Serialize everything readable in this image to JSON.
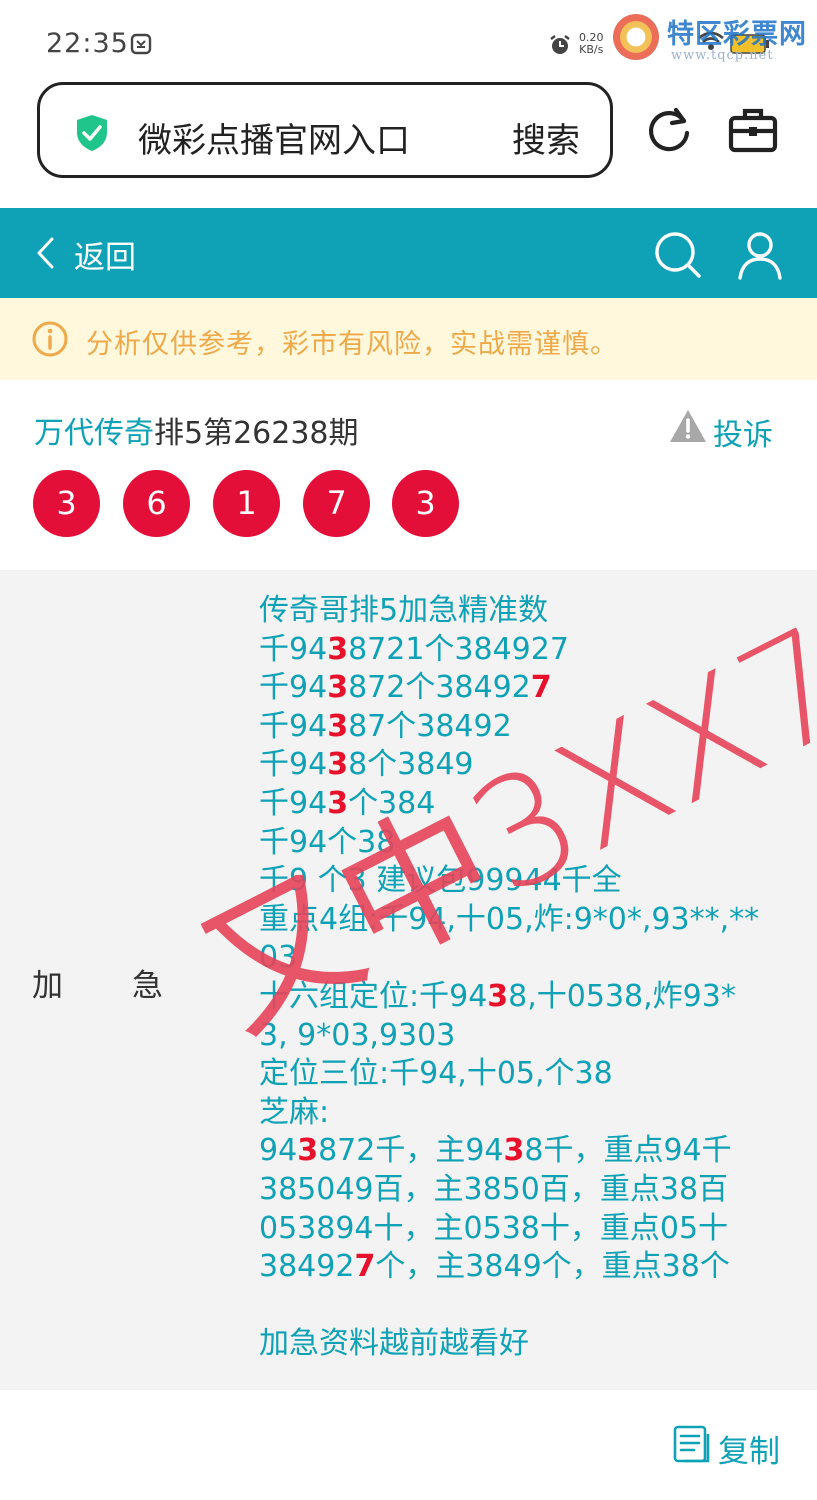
{
  "status_bar": {
    "time": "22:35",
    "net_speed_value": "0.20",
    "net_speed_unit": "KB/s"
  },
  "watermark": {
    "name": "特区彩票网",
    "url": "www.tqcp.net"
  },
  "search": {
    "query": "微彩点播官网入口",
    "button_label": "搜索"
  },
  "topbar": {
    "back_label": "返回"
  },
  "notice": {
    "text": "分析仅供参考，彩市有风险，实战需谨慎。"
  },
  "article": {
    "author": "万代传奇",
    "title_suffix": "排5第26238期",
    "report_label": "投诉",
    "balls": [
      "3",
      "6",
      "1",
      "7",
      "3"
    ],
    "row_label_1": "加",
    "row_label_2": "急",
    "lines": [
      [
        {
          "t": "传奇哥排5加急精准数"
        }
      ],
      [
        {
          "t": "千94"
        },
        {
          "t": "3",
          "h": true
        },
        {
          "t": "8721个384927"
        },
        {
          "t": "",
          "h": true
        }
      ],
      [
        {
          "t": "千94"
        },
        {
          "t": "3",
          "h": true
        },
        {
          "t": "872个38492"
        },
        {
          "t": "7",
          "h": true
        }
      ],
      [
        {
          "t": "千94"
        },
        {
          "t": "3",
          "h": true
        },
        {
          "t": "87个38492"
        }
      ],
      [
        {
          "t": "千94"
        },
        {
          "t": "3",
          "h": true
        },
        {
          "t": "8个3849"
        }
      ],
      [
        {
          "t": "千94"
        },
        {
          "t": "3",
          "h": true
        },
        {
          "t": "个384"
        }
      ],
      [
        {
          "t": "千94个38"
        }
      ],
      [
        {
          "t": "千9 个3 建议包99944千全"
        }
      ],
      [
        {
          "t": "重点4组:千94,十05,炸:9*0*,93**,**"
        }
      ],
      [
        {
          "t": "03"
        }
      ],
      [
        {
          "t": "十六组定位:千94"
        },
        {
          "t": "3",
          "h": true
        },
        {
          "t": "8,十0538,炸93*"
        }
      ],
      [
        {
          "t": "3, 9*03,9303"
        }
      ],
      [
        {
          "t": "定位三位:千94,十05,个38"
        }
      ],
      [
        {
          "t": "芝麻:"
        }
      ],
      [
        {
          "t": "94"
        },
        {
          "t": "3",
          "h": true
        },
        {
          "t": "872千，主94"
        },
        {
          "t": "3",
          "h": true
        },
        {
          "t": "8千，重点94千"
        }
      ],
      [
        {
          "t": "385049百，主3850百，重点38百"
        }
      ],
      [
        {
          "t": "053894十，主0538十，重点05十"
        }
      ],
      [
        {
          "t": "38492"
        },
        {
          "t": "7",
          "h": true
        },
        {
          "t": "个，主3849个，重点38个"
        }
      ],
      [
        {
          "t": ""
        }
      ],
      [
        {
          "t": "加急资料越前越看好"
        }
      ]
    ],
    "stamp_text": "又中3XX7",
    "copy_label": "复制"
  },
  "colors": {
    "teal": "#0fa1b6",
    "ball_red": "#e30f38",
    "highlight_red": "#e8102a",
    "notice_bg": "#fff8dc",
    "notice_text": "#f0a94a"
  }
}
